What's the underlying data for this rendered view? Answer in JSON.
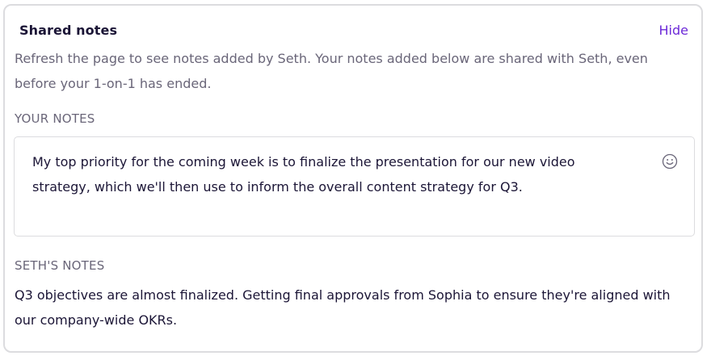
{
  "panel": {
    "title": "Shared notes",
    "hide_label": "Hide",
    "description": "Refresh the page to see notes added by Seth. Your notes added below are shared with Seth, even before your 1-on-1 has ended."
  },
  "your_notes": {
    "label": "YOUR NOTES",
    "text": "My top priority for the coming week is to finalize the presentation for our new video strategy, which we'll then use to inform the overall content strategy for Q3.",
    "emoji_icon": "smiley-face-icon"
  },
  "seth_notes": {
    "label": "SETH'S NOTES",
    "text": "Q3 objectives are almost finalized. Getting final approvals from Sophia to ensure they're aligned with our company-wide OKRs."
  },
  "colors": {
    "accent": "#6d2ad8",
    "text_primary": "#1b1536",
    "text_secondary": "#6a6679",
    "border": "#dcdcdf"
  }
}
